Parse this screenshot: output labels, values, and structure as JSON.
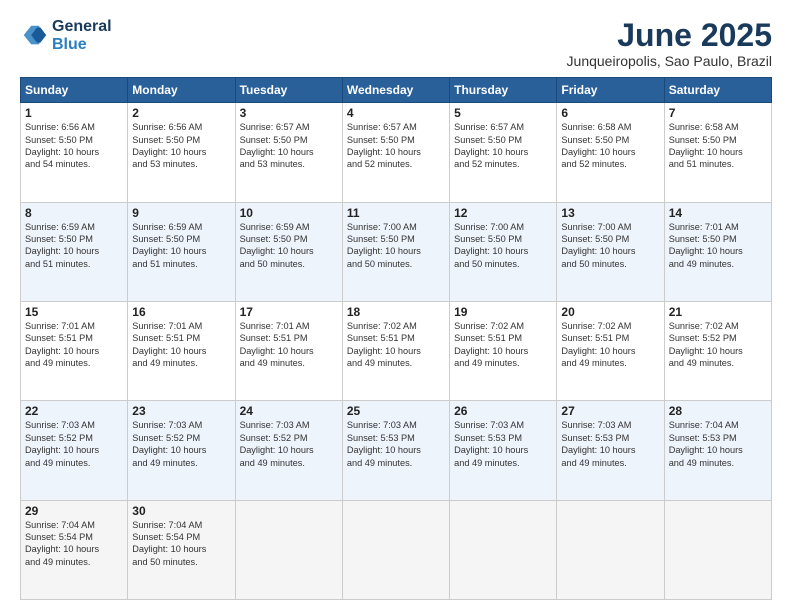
{
  "header": {
    "logo_line1": "General",
    "logo_line2": "Blue",
    "title": "June 2025",
    "subtitle": "Junqueiropolis, Sao Paulo, Brazil"
  },
  "columns": [
    "Sunday",
    "Monday",
    "Tuesday",
    "Wednesday",
    "Thursday",
    "Friday",
    "Saturday"
  ],
  "weeks": [
    {
      "days": [
        {
          "num": "1",
          "info": "Sunrise: 6:56 AM\nSunset: 5:50 PM\nDaylight: 10 hours\nand 54 minutes."
        },
        {
          "num": "2",
          "info": "Sunrise: 6:56 AM\nSunset: 5:50 PM\nDaylight: 10 hours\nand 53 minutes."
        },
        {
          "num": "3",
          "info": "Sunrise: 6:57 AM\nSunset: 5:50 PM\nDaylight: 10 hours\nand 53 minutes."
        },
        {
          "num": "4",
          "info": "Sunrise: 6:57 AM\nSunset: 5:50 PM\nDaylight: 10 hours\nand 52 minutes."
        },
        {
          "num": "5",
          "info": "Sunrise: 6:57 AM\nSunset: 5:50 PM\nDaylight: 10 hours\nand 52 minutes."
        },
        {
          "num": "6",
          "info": "Sunrise: 6:58 AM\nSunset: 5:50 PM\nDaylight: 10 hours\nand 52 minutes."
        },
        {
          "num": "7",
          "info": "Sunrise: 6:58 AM\nSunset: 5:50 PM\nDaylight: 10 hours\nand 51 minutes."
        }
      ]
    },
    {
      "days": [
        {
          "num": "8",
          "info": "Sunrise: 6:59 AM\nSunset: 5:50 PM\nDaylight: 10 hours\nand 51 minutes."
        },
        {
          "num": "9",
          "info": "Sunrise: 6:59 AM\nSunset: 5:50 PM\nDaylight: 10 hours\nand 51 minutes."
        },
        {
          "num": "10",
          "info": "Sunrise: 6:59 AM\nSunset: 5:50 PM\nDaylight: 10 hours\nand 50 minutes."
        },
        {
          "num": "11",
          "info": "Sunrise: 7:00 AM\nSunset: 5:50 PM\nDaylight: 10 hours\nand 50 minutes."
        },
        {
          "num": "12",
          "info": "Sunrise: 7:00 AM\nSunset: 5:50 PM\nDaylight: 10 hours\nand 50 minutes."
        },
        {
          "num": "13",
          "info": "Sunrise: 7:00 AM\nSunset: 5:50 PM\nDaylight: 10 hours\nand 50 minutes."
        },
        {
          "num": "14",
          "info": "Sunrise: 7:01 AM\nSunset: 5:50 PM\nDaylight: 10 hours\nand 49 minutes."
        }
      ]
    },
    {
      "days": [
        {
          "num": "15",
          "info": "Sunrise: 7:01 AM\nSunset: 5:51 PM\nDaylight: 10 hours\nand 49 minutes."
        },
        {
          "num": "16",
          "info": "Sunrise: 7:01 AM\nSunset: 5:51 PM\nDaylight: 10 hours\nand 49 minutes."
        },
        {
          "num": "17",
          "info": "Sunrise: 7:01 AM\nSunset: 5:51 PM\nDaylight: 10 hours\nand 49 minutes."
        },
        {
          "num": "18",
          "info": "Sunrise: 7:02 AM\nSunset: 5:51 PM\nDaylight: 10 hours\nand 49 minutes."
        },
        {
          "num": "19",
          "info": "Sunrise: 7:02 AM\nSunset: 5:51 PM\nDaylight: 10 hours\nand 49 minutes."
        },
        {
          "num": "20",
          "info": "Sunrise: 7:02 AM\nSunset: 5:51 PM\nDaylight: 10 hours\nand 49 minutes."
        },
        {
          "num": "21",
          "info": "Sunrise: 7:02 AM\nSunset: 5:52 PM\nDaylight: 10 hours\nand 49 minutes."
        }
      ]
    },
    {
      "days": [
        {
          "num": "22",
          "info": "Sunrise: 7:03 AM\nSunset: 5:52 PM\nDaylight: 10 hours\nand 49 minutes."
        },
        {
          "num": "23",
          "info": "Sunrise: 7:03 AM\nSunset: 5:52 PM\nDaylight: 10 hours\nand 49 minutes."
        },
        {
          "num": "24",
          "info": "Sunrise: 7:03 AM\nSunset: 5:52 PM\nDaylight: 10 hours\nand 49 minutes."
        },
        {
          "num": "25",
          "info": "Sunrise: 7:03 AM\nSunset: 5:53 PM\nDaylight: 10 hours\nand 49 minutes."
        },
        {
          "num": "26",
          "info": "Sunrise: 7:03 AM\nSunset: 5:53 PM\nDaylight: 10 hours\nand 49 minutes."
        },
        {
          "num": "27",
          "info": "Sunrise: 7:03 AM\nSunset: 5:53 PM\nDaylight: 10 hours\nand 49 minutes."
        },
        {
          "num": "28",
          "info": "Sunrise: 7:04 AM\nSunset: 5:53 PM\nDaylight: 10 hours\nand 49 minutes."
        }
      ]
    },
    {
      "days": [
        {
          "num": "29",
          "info": "Sunrise: 7:04 AM\nSunset: 5:54 PM\nDaylight: 10 hours\nand 49 minutes."
        },
        {
          "num": "30",
          "info": "Sunrise: 7:04 AM\nSunset: 5:54 PM\nDaylight: 10 hours\nand 50 minutes."
        },
        {
          "num": "",
          "info": ""
        },
        {
          "num": "",
          "info": ""
        },
        {
          "num": "",
          "info": ""
        },
        {
          "num": "",
          "info": ""
        },
        {
          "num": "",
          "info": ""
        }
      ]
    }
  ]
}
